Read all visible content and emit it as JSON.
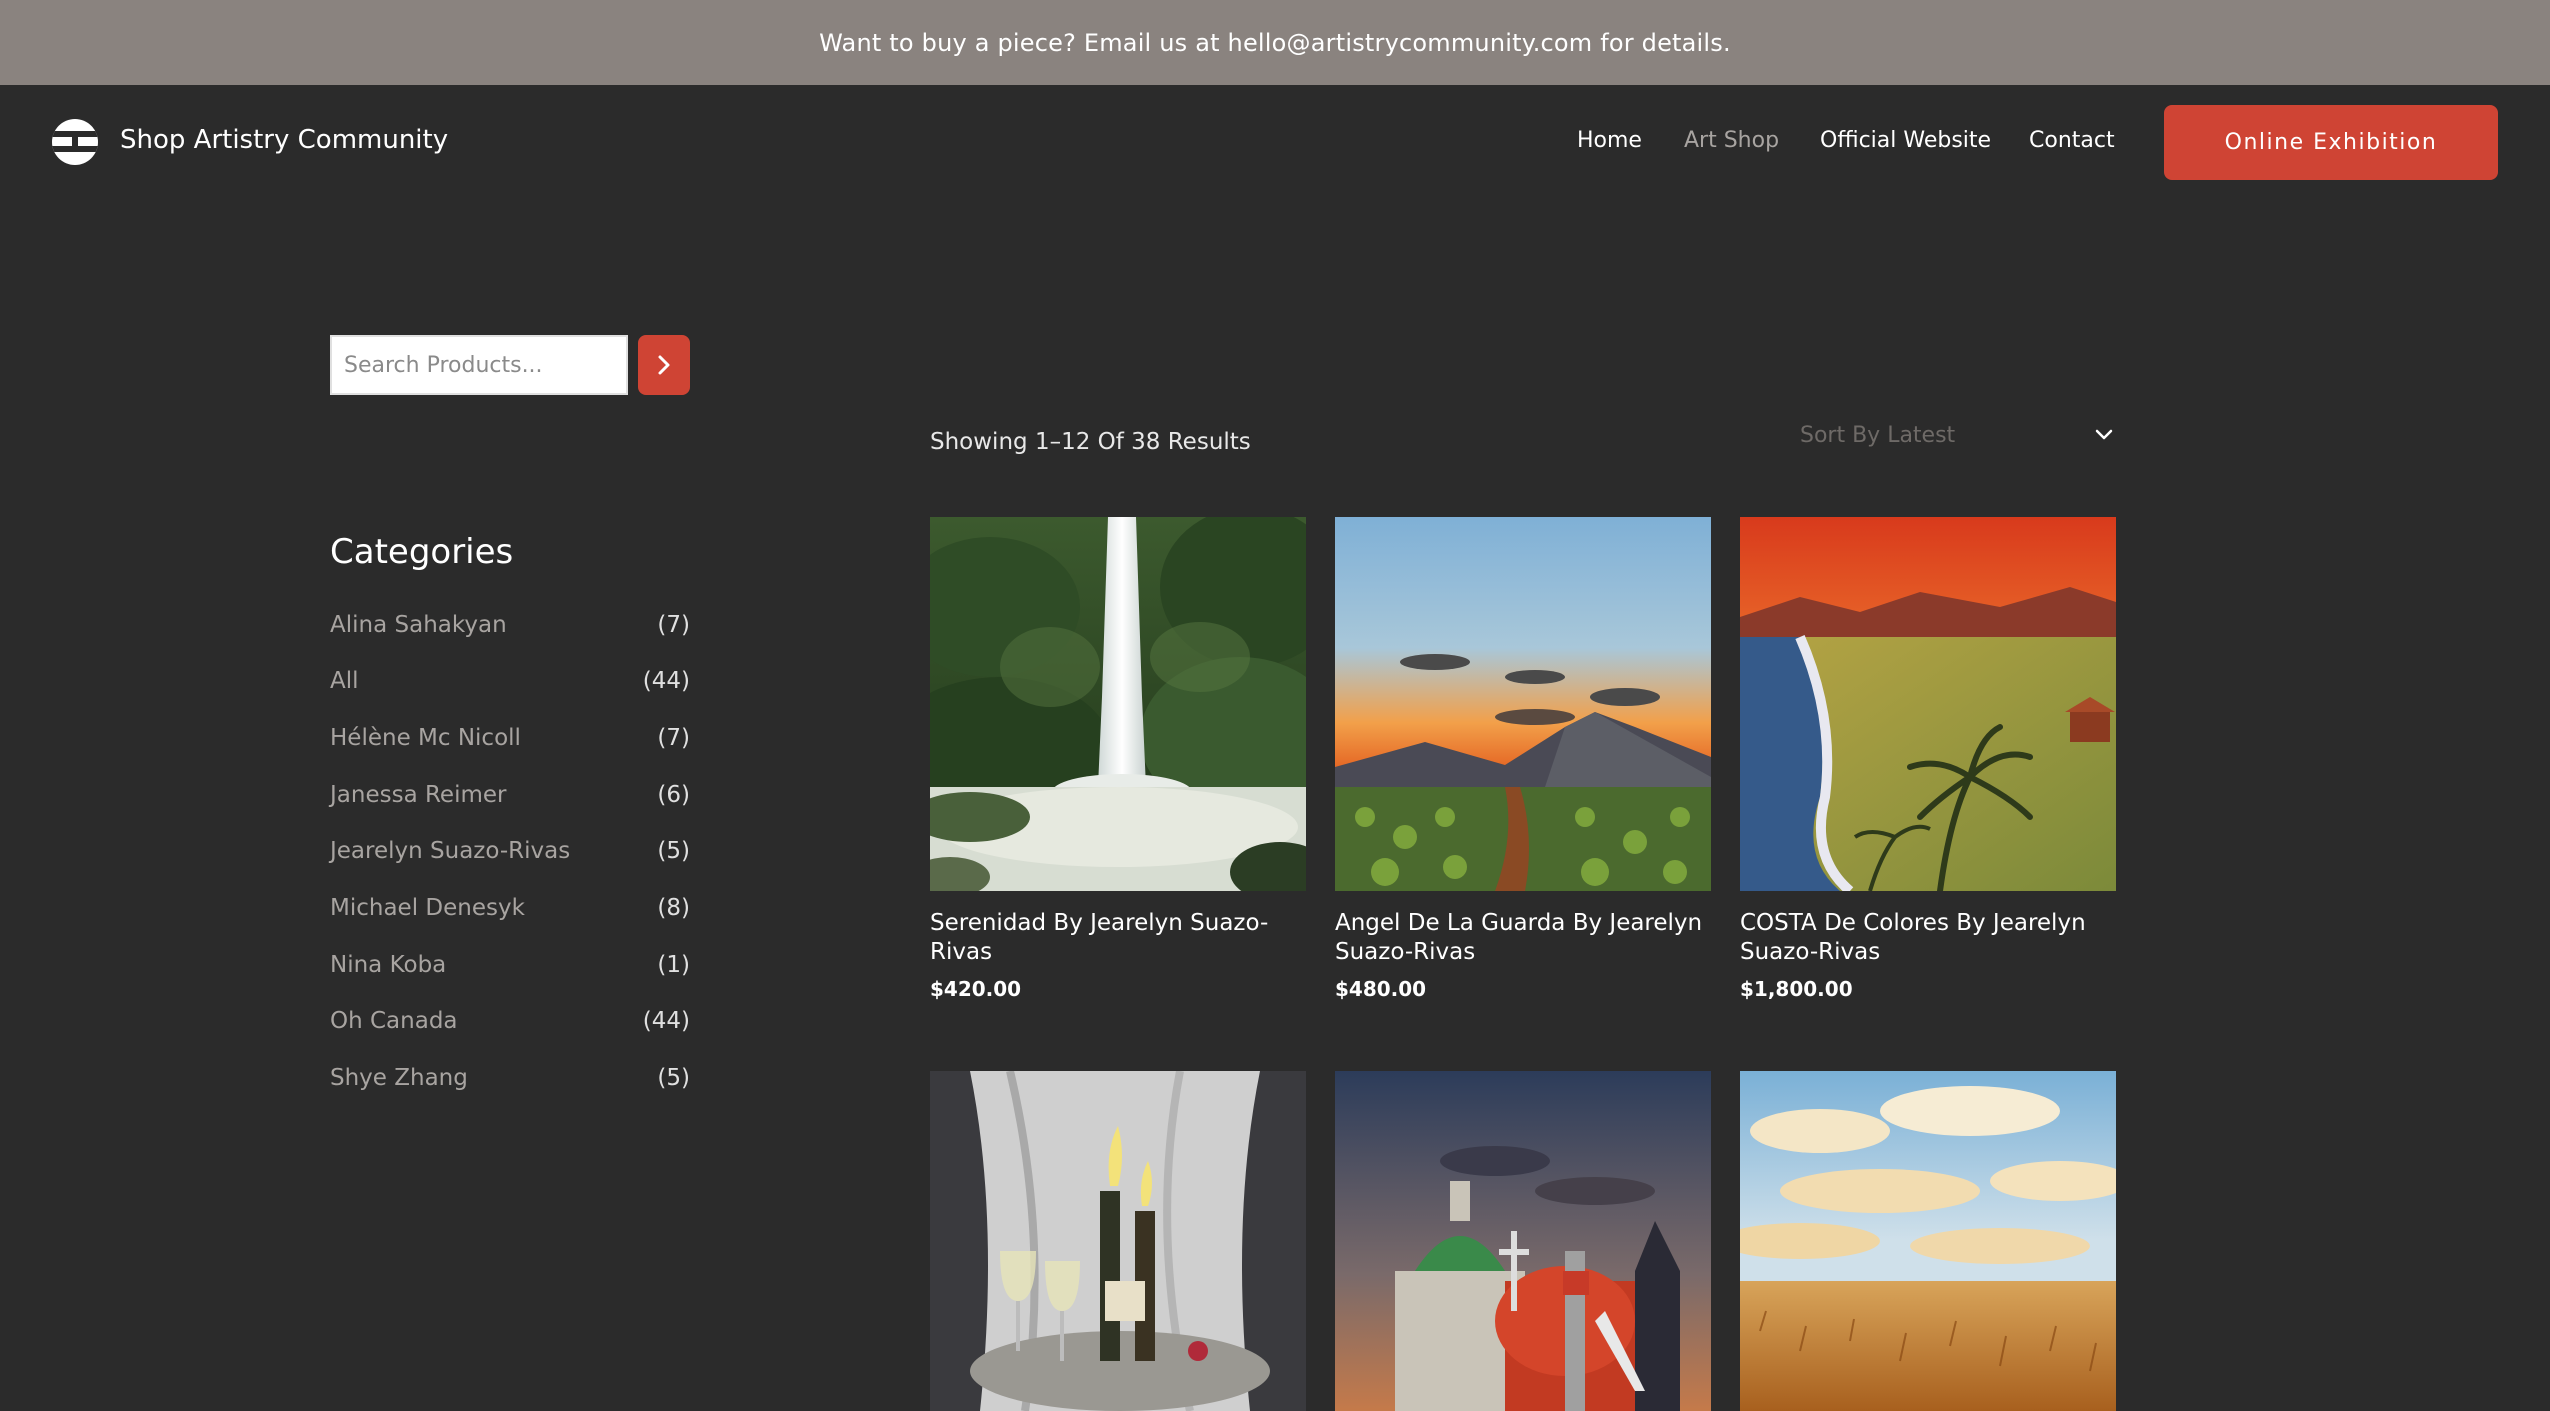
{
  "announcement": "Want to buy a piece? Email us at hello@artistrycommunity.com for details.",
  "header": {
    "brand": "Shop Artistry Community",
    "nav": [
      "Home",
      "Art Shop",
      "Official Website",
      "Contact"
    ],
    "cta": "Online Exhibition"
  },
  "sidebar": {
    "search_placeholder": "Search Products...",
    "categories_title": "Categories",
    "categories": [
      {
        "name": "Alina Sahakyan",
        "count": "(7)"
      },
      {
        "name": "All",
        "count": "(44)"
      },
      {
        "name": "Hélène Mc Nicoll",
        "count": "(7)"
      },
      {
        "name": "Janessa Reimer",
        "count": "(6)"
      },
      {
        "name": "Jearelyn Suazo-Rivas",
        "count": "(5)"
      },
      {
        "name": "Michael Denesyk",
        "count": "(8)"
      },
      {
        "name": "Nina Koba",
        "count": "(1)"
      },
      {
        "name": "Oh Canada",
        "count": "(44)"
      },
      {
        "name": "Shye Zhang",
        "count": "(5)"
      }
    ]
  },
  "main": {
    "results_text": "Showing 1–12 Of 38 Results",
    "sort_label": "Sort By Latest",
    "products": [
      {
        "title": "Serenidad By Jearelyn Suazo-Rivas",
        "price": "$420.00"
      },
      {
        "title": "Angel De La Guarda By Jearelyn Suazo-Rivas",
        "price": "$480.00"
      },
      {
        "title": "COSTA De Colores By Jearelyn Suazo-Rivas",
        "price": "$1,800.00"
      }
    ]
  },
  "colors": {
    "background": "#2b2b2b",
    "announcement_bar": "#8a837f",
    "accent": "#cf4434",
    "muted_text": "#a8a4a1"
  }
}
